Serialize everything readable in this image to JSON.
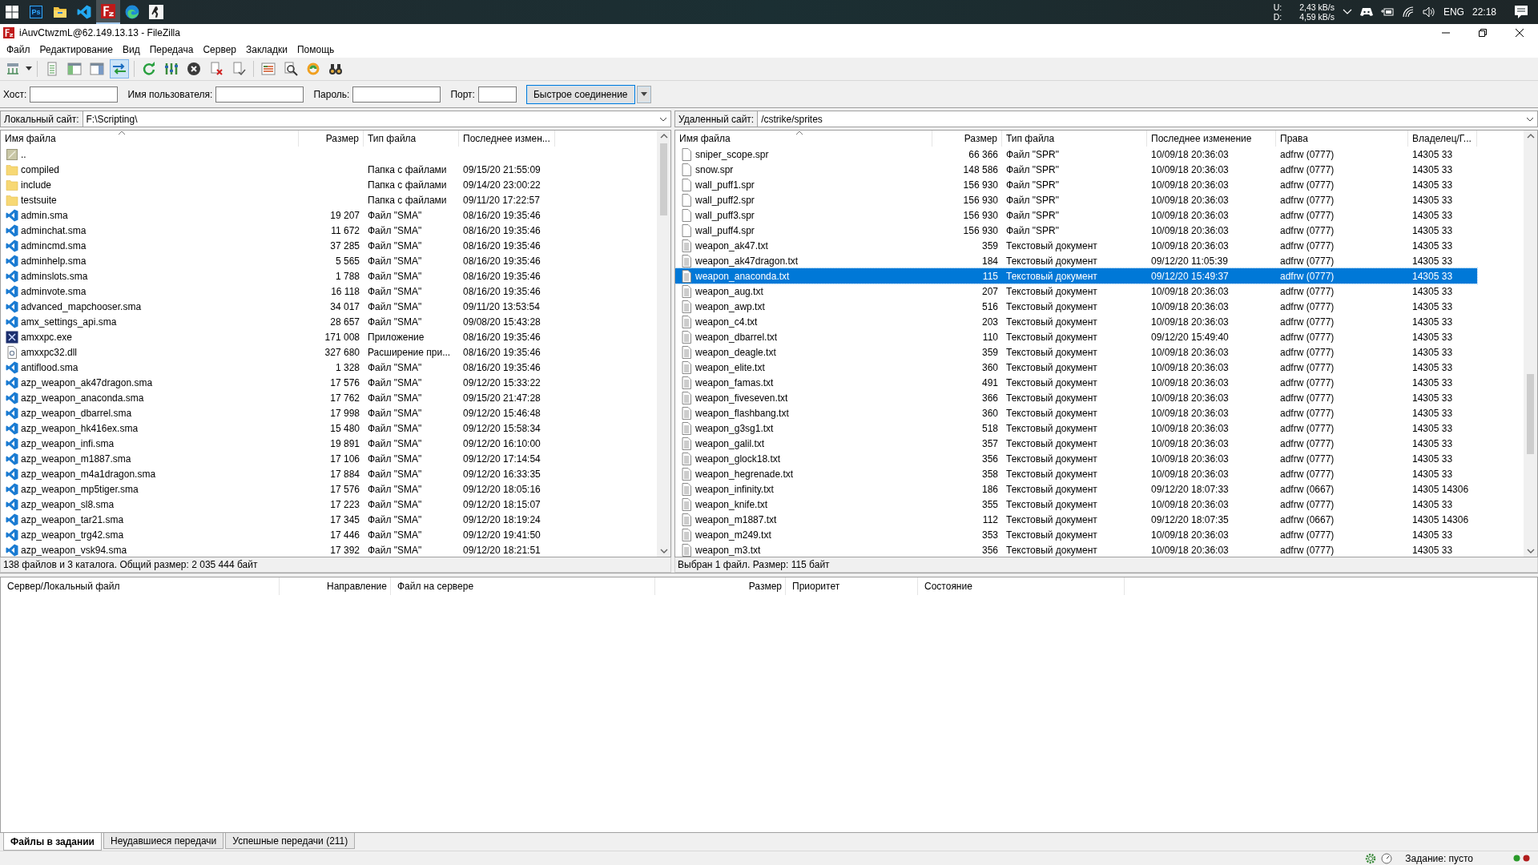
{
  "taskbar": {
    "apps": [
      {
        "kind": "start",
        "selected": false
      },
      {
        "kind": "photoshop",
        "label": "Ps",
        "selected": false
      },
      {
        "kind": "explorer",
        "selected": false
      },
      {
        "kind": "code",
        "selected": false
      },
      {
        "kind": "filezilla",
        "selected": true
      },
      {
        "kind": "browser",
        "selected": false
      },
      {
        "kind": "game",
        "selected": false
      }
    ],
    "up_label": "U:",
    "down_label": "D:",
    "up_speed": "2,43 kB/s",
    "down_speed": "4,59 kB/s",
    "language": "ENG",
    "time": "22:18"
  },
  "window": {
    "title": "iAuvCtwzmL@62.149.13.13 - FileZilla"
  },
  "menu": [
    "Файл",
    "Редактирование",
    "Вид",
    "Передача",
    "Сервер",
    "Закладки",
    "Помощь"
  ],
  "toolbar": {
    "sync_browsing_on": true
  },
  "quickconnect": {
    "host_label": "Хост:",
    "user_label": "Имя пользователя:",
    "password_label": "Пароль:",
    "port_label": "Порт:",
    "button": "Быстрое соединение"
  },
  "local": {
    "site_label": "Локальный сайт:",
    "path": "F:\\Scripting\\",
    "columns": [
      "Имя файла",
      "Размер",
      "Тип файла",
      "Последнее измен..."
    ],
    "rows": [
      {
        "kind": "parent",
        "name": "..",
        "selected": false
      },
      {
        "kind": "folder",
        "name": "compiled",
        "type": "Папка с файлами",
        "modified": "09/15/20 21:55:09",
        "selected": false
      },
      {
        "kind": "folder",
        "name": "include",
        "type": "Папка с файлами",
        "modified": "09/14/20 23:00:22",
        "selected": false
      },
      {
        "kind": "folder",
        "name": "testsuite",
        "type": "Папка с файлами",
        "modified": "09/11/20 17:22:57",
        "selected": false
      },
      {
        "kind": "sma",
        "name": "admin.sma",
        "size": "19 207",
        "type": "Файл \"SMA\"",
        "modified": "08/16/20 19:35:46",
        "selected": false
      },
      {
        "kind": "sma",
        "name": "adminchat.sma",
        "size": "11 672",
        "type": "Файл \"SMA\"",
        "modified": "08/16/20 19:35:46",
        "selected": false
      },
      {
        "kind": "sma",
        "name": "admincmd.sma",
        "size": "37 285",
        "type": "Файл \"SMA\"",
        "modified": "08/16/20 19:35:46",
        "selected": false
      },
      {
        "kind": "sma",
        "name": "adminhelp.sma",
        "size": "5 565",
        "type": "Файл \"SMA\"",
        "modified": "08/16/20 19:35:46",
        "selected": false
      },
      {
        "kind": "sma",
        "name": "adminslots.sma",
        "size": "1 788",
        "type": "Файл \"SMA\"",
        "modified": "08/16/20 19:35:46",
        "selected": false
      },
      {
        "kind": "sma",
        "name": "adminvote.sma",
        "size": "16 118",
        "type": "Файл \"SMA\"",
        "modified": "08/16/20 19:35:46",
        "selected": false
      },
      {
        "kind": "sma",
        "name": "advanced_mapchooser.sma",
        "size": "34 017",
        "type": "Файл \"SMA\"",
        "modified": "09/11/20 13:53:54",
        "selected": false
      },
      {
        "kind": "sma",
        "name": "amx_settings_api.sma",
        "size": "28 657",
        "type": "Файл \"SMA\"",
        "modified": "09/08/20 15:43:28",
        "selected": false
      },
      {
        "kind": "exe",
        "name": "amxxpc.exe",
        "size": "171 008",
        "type": "Приложение",
        "modified": "08/16/20 19:35:46",
        "selected": false
      },
      {
        "kind": "dll",
        "name": "amxxpc32.dll",
        "size": "327 680",
        "type": "Расширение при...",
        "modified": "08/16/20 19:35:46",
        "selected": false
      },
      {
        "kind": "sma",
        "name": "antiflood.sma",
        "size": "1 328",
        "type": "Файл \"SMA\"",
        "modified": "08/16/20 19:35:46",
        "selected": false
      },
      {
        "kind": "sma",
        "name": "azp_weapon_ak47dragon.sma",
        "size": "17 576",
        "type": "Файл \"SMA\"",
        "modified": "09/12/20 15:33:22",
        "selected": false
      },
      {
        "kind": "sma",
        "name": "azp_weapon_anaconda.sma",
        "size": "17 762",
        "type": "Файл \"SMA\"",
        "modified": "09/15/20 21:47:28",
        "selected": false
      },
      {
        "kind": "sma",
        "name": "azp_weapon_dbarrel.sma",
        "size": "17 998",
        "type": "Файл \"SMA\"",
        "modified": "09/12/20 15:46:48",
        "selected": false
      },
      {
        "kind": "sma",
        "name": "azp_weapon_hk416ex.sma",
        "size": "15 480",
        "type": "Файл \"SMA\"",
        "modified": "09/12/20 15:58:34",
        "selected": false
      },
      {
        "kind": "sma",
        "name": "azp_weapon_infi.sma",
        "size": "19 891",
        "type": "Файл \"SMA\"",
        "modified": "09/12/20 16:10:00",
        "selected": false
      },
      {
        "kind": "sma",
        "name": "azp_weapon_m1887.sma",
        "size": "17 106",
        "type": "Файл \"SMA\"",
        "modified": "09/12/20 17:14:54",
        "selected": false
      },
      {
        "kind": "sma",
        "name": "azp_weapon_m4a1dragon.sma",
        "size": "17 884",
        "type": "Файл \"SMA\"",
        "modified": "09/12/20 16:33:35",
        "selected": false
      },
      {
        "kind": "sma",
        "name": "azp_weapon_mp5tiger.sma",
        "size": "17 576",
        "type": "Файл \"SMA\"",
        "modified": "09/12/20 18:05:16",
        "selected": false
      },
      {
        "kind": "sma",
        "name": "azp_weapon_sl8.sma",
        "size": "17 223",
        "type": "Файл \"SMA\"",
        "modified": "09/12/20 18:15:07",
        "selected": false
      },
      {
        "kind": "sma",
        "name": "azp_weapon_tar21.sma",
        "size": "17 345",
        "type": "Файл \"SMA\"",
        "modified": "09/12/20 18:19:24",
        "selected": false
      },
      {
        "kind": "sma",
        "name": "azp_weapon_trg42.sma",
        "size": "17 446",
        "type": "Файл \"SMA\"",
        "modified": "09/12/20 19:41:50",
        "selected": false
      },
      {
        "kind": "sma",
        "name": "azp_weapon_vsk94.sma",
        "size": "17 392",
        "type": "Файл \"SMA\"",
        "modified": "09/12/20 18:21:51",
        "selected": false
      }
    ],
    "status": "138 файлов и 3 каталога. Общий размер: 2 035 444 байт"
  },
  "remote": {
    "site_label": "Удаленный сайт:",
    "path": "/cstrike/sprites",
    "columns": [
      "Имя файла",
      "Размер",
      "Тип файла",
      "Последнее изменение",
      "Права",
      "Владелец/Г..."
    ],
    "rows": [
      {
        "kind": "spr",
        "name": "sniper_scope.spr",
        "size": "66 366",
        "type": "Файл \"SPR\"",
        "modified": "10/09/18 20:36:03",
        "permissions": "adfrw (0777)",
        "owner": "14305 33",
        "selected": false
      },
      {
        "kind": "spr",
        "name": "snow.spr",
        "size": "148 586",
        "type": "Файл \"SPR\"",
        "modified": "10/09/18 20:36:03",
        "permissions": "adfrw (0777)",
        "owner": "14305 33",
        "selected": false
      },
      {
        "kind": "spr",
        "name": "wall_puff1.spr",
        "size": "156 930",
        "type": "Файл \"SPR\"",
        "modified": "10/09/18 20:36:03",
        "permissions": "adfrw (0777)",
        "owner": "14305 33",
        "selected": false
      },
      {
        "kind": "spr",
        "name": "wall_puff2.spr",
        "size": "156 930",
        "type": "Файл \"SPR\"",
        "modified": "10/09/18 20:36:03",
        "permissions": "adfrw (0777)",
        "owner": "14305 33",
        "selected": false
      },
      {
        "kind": "spr",
        "name": "wall_puff3.spr",
        "size": "156 930",
        "type": "Файл \"SPR\"",
        "modified": "10/09/18 20:36:03",
        "permissions": "adfrw (0777)",
        "owner": "14305 33",
        "selected": false
      },
      {
        "kind": "spr",
        "name": "wall_puff4.spr",
        "size": "156 930",
        "type": "Файл \"SPR\"",
        "modified": "10/09/18 20:36:03",
        "permissions": "adfrw (0777)",
        "owner": "14305 33",
        "selected": false
      },
      {
        "kind": "txt",
        "name": "weapon_ak47.txt",
        "size": "359",
        "type": "Текстовый документ",
        "modified": "10/09/18 20:36:03",
        "permissions": "adfrw (0777)",
        "owner": "14305 33",
        "selected": false
      },
      {
        "kind": "txt",
        "name": "weapon_ak47dragon.txt",
        "size": "184",
        "type": "Текстовый документ",
        "modified": "09/12/20 11:05:39",
        "permissions": "adfrw (0777)",
        "owner": "14305 33",
        "selected": false
      },
      {
        "kind": "txt",
        "name": "weapon_anaconda.txt",
        "size": "115",
        "type": "Текстовый документ",
        "modified": "09/12/20 15:49:37",
        "permissions": "adfrw (0777)",
        "owner": "14305 33",
        "selected": true
      },
      {
        "kind": "txt",
        "name": "weapon_aug.txt",
        "size": "207",
        "type": "Текстовый документ",
        "modified": "10/09/18 20:36:03",
        "permissions": "adfrw (0777)",
        "owner": "14305 33",
        "selected": false
      },
      {
        "kind": "txt",
        "name": "weapon_awp.txt",
        "size": "516",
        "type": "Текстовый документ",
        "modified": "10/09/18 20:36:03",
        "permissions": "adfrw (0777)",
        "owner": "14305 33",
        "selected": false
      },
      {
        "kind": "txt",
        "name": "weapon_c4.txt",
        "size": "203",
        "type": "Текстовый документ",
        "modified": "10/09/18 20:36:03",
        "permissions": "adfrw (0777)",
        "owner": "14305 33",
        "selected": false
      },
      {
        "kind": "txt",
        "name": "weapon_dbarrel.txt",
        "size": "110",
        "type": "Текстовый документ",
        "modified": "09/12/20 15:49:40",
        "permissions": "adfrw (0777)",
        "owner": "14305 33",
        "selected": false
      },
      {
        "kind": "txt",
        "name": "weapon_deagle.txt",
        "size": "359",
        "type": "Текстовый документ",
        "modified": "10/09/18 20:36:03",
        "permissions": "adfrw (0777)",
        "owner": "14305 33",
        "selected": false
      },
      {
        "kind": "txt",
        "name": "weapon_elite.txt",
        "size": "360",
        "type": "Текстовый документ",
        "modified": "10/09/18 20:36:03",
        "permissions": "adfrw (0777)",
        "owner": "14305 33",
        "selected": false
      },
      {
        "kind": "txt",
        "name": "weapon_famas.txt",
        "size": "491",
        "type": "Текстовый документ",
        "modified": "10/09/18 20:36:03",
        "permissions": "adfrw (0777)",
        "owner": "14305 33",
        "selected": false
      },
      {
        "kind": "txt",
        "name": "weapon_fiveseven.txt",
        "size": "366",
        "type": "Текстовый документ",
        "modified": "10/09/18 20:36:03",
        "permissions": "adfrw (0777)",
        "owner": "14305 33",
        "selected": false
      },
      {
        "kind": "txt",
        "name": "weapon_flashbang.txt",
        "size": "360",
        "type": "Текстовый документ",
        "modified": "10/09/18 20:36:03",
        "permissions": "adfrw (0777)",
        "owner": "14305 33",
        "selected": false
      },
      {
        "kind": "txt",
        "name": "weapon_g3sg1.txt",
        "size": "518",
        "type": "Текстовый документ",
        "modified": "10/09/18 20:36:03",
        "permissions": "adfrw (0777)",
        "owner": "14305 33",
        "selected": false
      },
      {
        "kind": "txt",
        "name": "weapon_galil.txt",
        "size": "357",
        "type": "Текстовый документ",
        "modified": "10/09/18 20:36:03",
        "permissions": "adfrw (0777)",
        "owner": "14305 33",
        "selected": false
      },
      {
        "kind": "txt",
        "name": "weapon_glock18.txt",
        "size": "356",
        "type": "Текстовый документ",
        "modified": "10/09/18 20:36:03",
        "permissions": "adfrw (0777)",
        "owner": "14305 33",
        "selected": false
      },
      {
        "kind": "txt",
        "name": "weapon_hegrenade.txt",
        "size": "358",
        "type": "Текстовый документ",
        "modified": "10/09/18 20:36:03",
        "permissions": "adfrw (0777)",
        "owner": "14305 33",
        "selected": false
      },
      {
        "kind": "txt",
        "name": "weapon_infinity.txt",
        "size": "186",
        "type": "Текстовый документ",
        "modified": "09/12/20 18:07:33",
        "permissions": "adfrw (0667)",
        "owner": "14305 14306",
        "selected": false
      },
      {
        "kind": "txt",
        "name": "weapon_knife.txt",
        "size": "355",
        "type": "Текстовый документ",
        "modified": "10/09/18 20:36:03",
        "permissions": "adfrw (0777)",
        "owner": "14305 33",
        "selected": false
      },
      {
        "kind": "txt",
        "name": "weapon_m1887.txt",
        "size": "112",
        "type": "Текстовый документ",
        "modified": "09/12/20 18:07:35",
        "permissions": "adfrw (0667)",
        "owner": "14305 14306",
        "selected": false
      },
      {
        "kind": "txt",
        "name": "weapon_m249.txt",
        "size": "353",
        "type": "Текстовый документ",
        "modified": "10/09/18 20:36:03",
        "permissions": "adfrw (0777)",
        "owner": "14305 33",
        "selected": false
      },
      {
        "kind": "txt",
        "name": "weapon_m3.txt",
        "size": "356",
        "type": "Текстовый документ",
        "modified": "10/09/18 20:36:03",
        "permissions": "adfrw (0777)",
        "owner": "14305 33",
        "selected": false
      }
    ],
    "status": "Выбран 1 файл. Размер: 115 байт"
  },
  "queue": {
    "columns": [
      "Сервер/Локальный файл",
      "Направление",
      "Файл на сервере",
      "Размер",
      "Приоритет",
      "Состояние"
    ]
  },
  "queue_tabs": [
    {
      "label": "Файлы в задании",
      "selected": true
    },
    {
      "label": "Неудавшиеся передачи",
      "selected": false
    },
    {
      "label": "Успешные передачи (211)",
      "selected": false
    }
  ],
  "status_bar": {
    "queue_status": "Задание: пусто"
  }
}
